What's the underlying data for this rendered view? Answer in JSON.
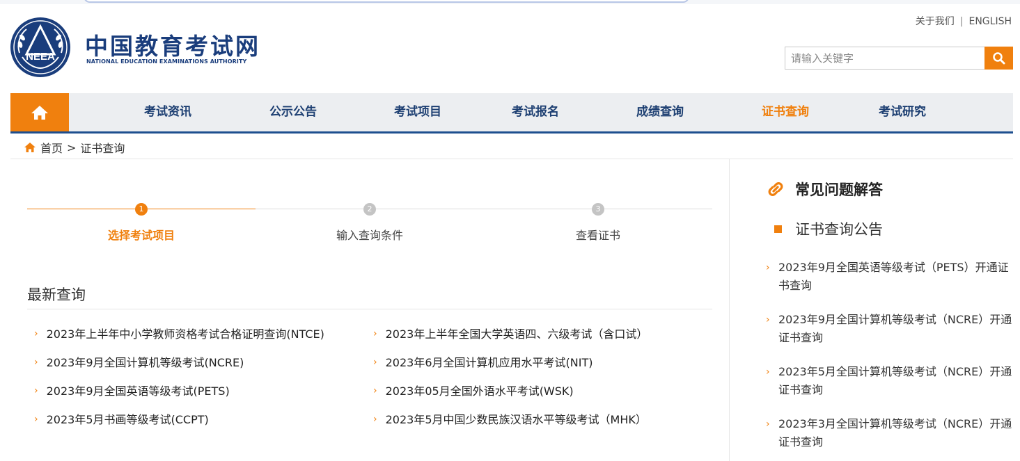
{
  "site": {
    "title": "中国教育考试网",
    "subtitle": "NATIONAL EDUCATION EXAMINATIONS AUTHORITY",
    "emblem_text": "NEEA"
  },
  "top_links": {
    "about": "关于我们",
    "separator": "|",
    "english": "ENGLISH"
  },
  "search": {
    "placeholder": "请输入关键字",
    "button_icon": "search-icon"
  },
  "colors": {
    "accent": "#f0800e",
    "brand": "#1a3d7c",
    "nav_bg": "#eceef1"
  },
  "nav": {
    "home_icon": "home-icon",
    "items": [
      {
        "label": "考试资讯",
        "active": false
      },
      {
        "label": "公示公告",
        "active": false
      },
      {
        "label": "考试项目",
        "active": false
      },
      {
        "label": "考试报名",
        "active": false
      },
      {
        "label": "成绩查询",
        "active": false
      },
      {
        "label": "证书查询",
        "active": true
      },
      {
        "label": "考试研究",
        "active": false
      }
    ]
  },
  "breadcrumb": {
    "home": "首页",
    "separator": ">",
    "current": "证书查询"
  },
  "steps": [
    {
      "num": "1",
      "label": "选择考试项目",
      "active": true
    },
    {
      "num": "2",
      "label": "输入查询条件",
      "active": false
    },
    {
      "num": "3",
      "label": "查看证书",
      "active": false
    }
  ],
  "recent": {
    "title": "最新查询",
    "items": [
      "2023年上半年中小学教师资格考试合格证明查询(NTCE)",
      "2023年上半年全国大学英语四、六级考试（含口试）",
      "2023年9月全国计算机等级考试(NCRE)",
      "2023年6月全国计算机应用水平考试(NIT)",
      "2023年9月全国英语等级考试(PETS)",
      "2023年05月全国外语水平考试(WSK)",
      "2023年5月书画等级考试(CCPT)",
      "2023年5月中国少数民族汉语水平等级考试（MHK）"
    ]
  },
  "sidebar": {
    "faq_title": "常见问题解答",
    "announce_title": "证书查询公告",
    "items": [
      "2023年9月全国英语等级考试（PETS）开通证书查询",
      "2023年9月全国计算机等级考试（NCRE）开通证书查询",
      "2023年5月全国计算机等级考试（NCRE）开通证书查询",
      "2023年3月全国计算机等级考试（NCRE）开通证书查询"
    ]
  }
}
